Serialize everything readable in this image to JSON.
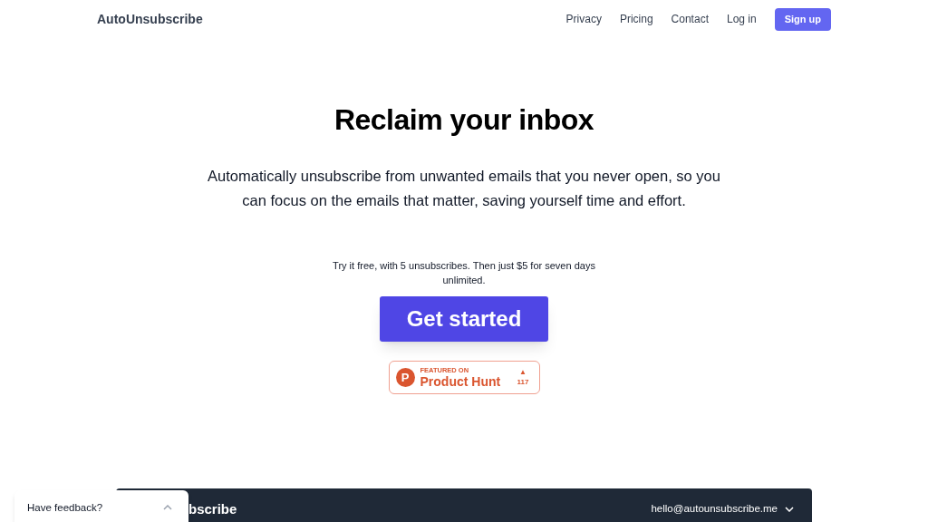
{
  "nav": {
    "logo": "AutoUnsubscribe",
    "links": [
      "Privacy",
      "Pricing",
      "Contact",
      "Log in"
    ],
    "signup": "Sign up"
  },
  "hero": {
    "title": "Reclaim your inbox",
    "subtitle": "Automatically unsubscribe from unwanted emails that you never open, so you can focus on the emails that matter, saving yourself time and effort.",
    "offer": "Try it free, with 5 unsubscribes. Then just $5 for seven days unlimited.",
    "cta": "Get started"
  },
  "product_hunt": {
    "letter": "P",
    "featured": "FEATURED ON",
    "name": "Product Hunt",
    "arrow": "▲",
    "votes": "117"
  },
  "app_preview": {
    "title": "bscribe",
    "account": "hello@autounsubscribe.me"
  },
  "feedback": {
    "label": "Have feedback?"
  }
}
